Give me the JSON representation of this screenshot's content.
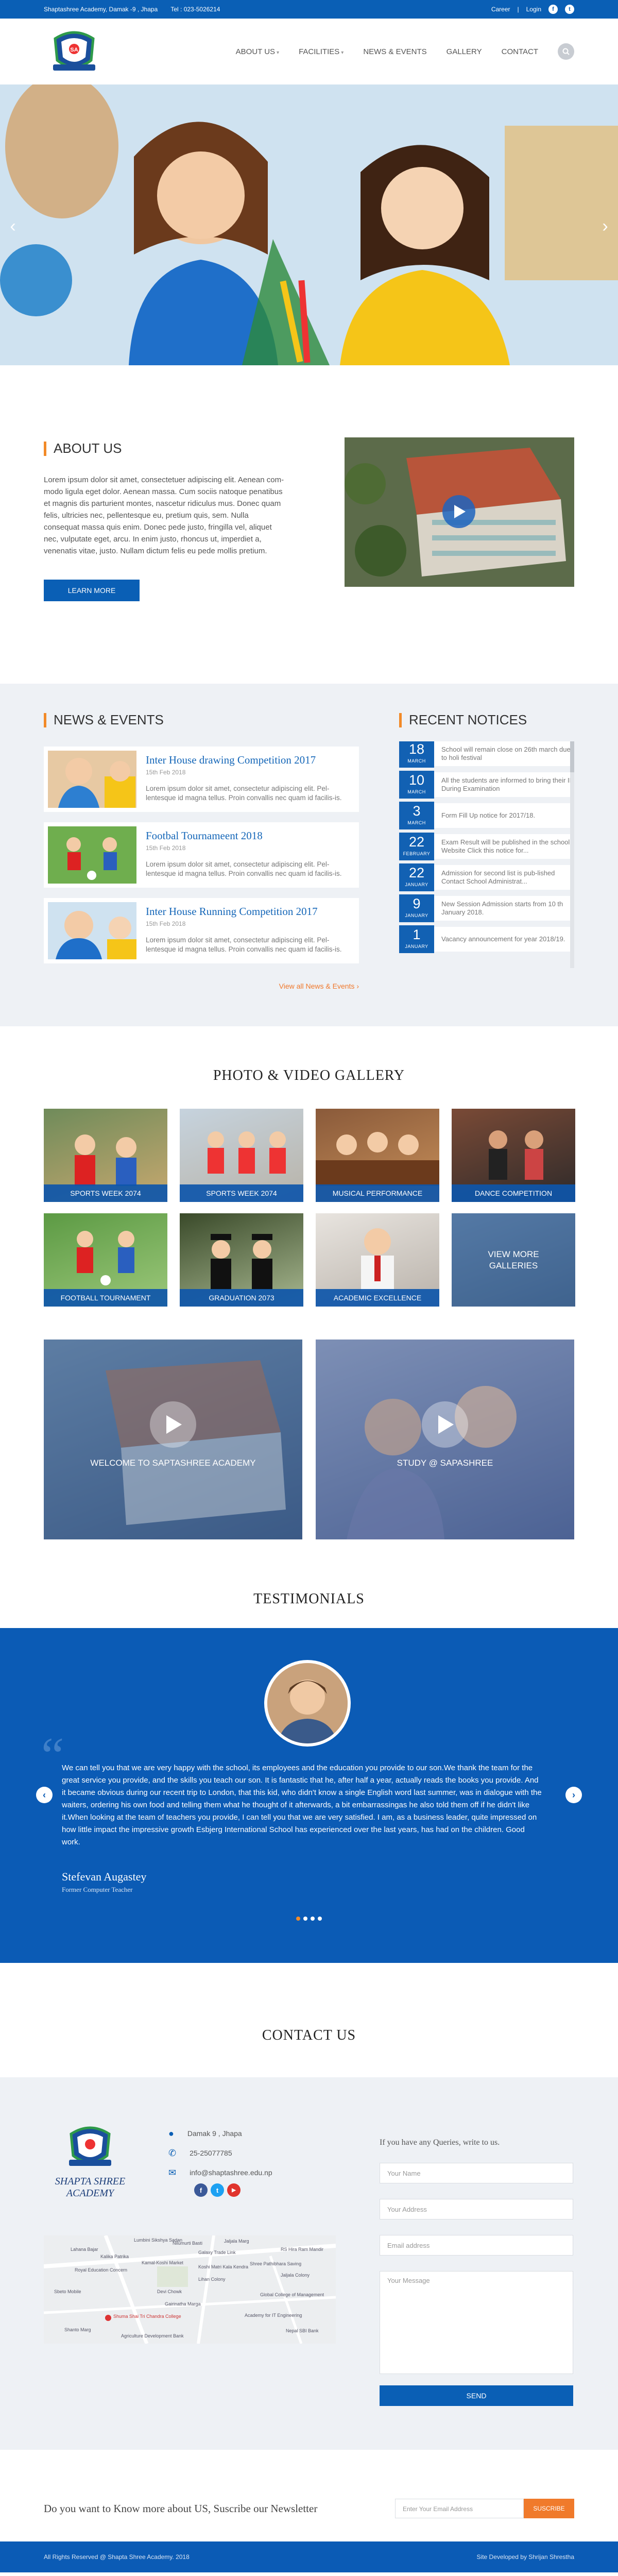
{
  "topbar": {
    "address": "Shaptashree Academy, Damak -9 , Jhapa",
    "phone": "Tel : 023-5026214",
    "career": "Career",
    "separator": "|",
    "login": "Login",
    "facebook_icon": "f",
    "twitter_icon": "t"
  },
  "logo": {
    "badge_text": "SA"
  },
  "nav": {
    "items": [
      {
        "label": "ABOUT US",
        "has_dropdown": true
      },
      {
        "label": "FACILITIES",
        "has_dropdown": true
      },
      {
        "label": "NEWS & EVENTS",
        "has_dropdown": false
      },
      {
        "label": "GALLERY",
        "has_dropdown": false
      },
      {
        "label": "CONTACT",
        "has_dropdown": false
      }
    ],
    "search_icon": "search-icon"
  },
  "hero": {
    "prev": "‹",
    "next": "›"
  },
  "about": {
    "title": "ABOUT US",
    "text": "Lorem ipsum dolor sit amet, consectetuer adipiscing elit. Aenean com-modo ligula eget dolor. Aenean massa. Cum sociis natoque penatibus et magnis dis parturient montes, nascetur ridiculus mus. Donec quam felis, ultricies nec, pellentesque eu, pretium quis, sem. Nulla consequat massa quis enim. Donec pede justo, fringilla vel, aliquet nec, vulputate eget, arcu. In enim justo, rhoncus ut, imperdiet a, venenatis vitae, justo. Nullam dictum felis eu pede mollis pretium.",
    "button": "LEARN MORE"
  },
  "news": {
    "title": "NEWS & EVENTS",
    "items": [
      {
        "title": "Inter House drawing Competition 2017",
        "date": "15th Feb 2018",
        "text": "Lorem ipsum dolor sit amet, consectetur adipiscing elit. Pel-lentesque id magna tellus. Proin convallis nec quam id facilis-is."
      },
      {
        "title": "Footbal Tournameent 2018",
        "date": "15th Feb 2018",
        "text": "Lorem ipsum dolor sit amet, consectetur adipiscing elit. Pel-lentesque id magna tellus. Proin convallis nec quam id facilis-is."
      },
      {
        "title": "Inter House Running Competition 2017",
        "date": "15th Feb 2018",
        "text": "Lorem ipsum dolor sit amet, consectetur adipiscing elit. Pel-lentesque id magna tellus. Proin convallis nec quam id facilis-is."
      }
    ],
    "view_all": "View all News & Events"
  },
  "notices": {
    "title": "RECENT NOTICES",
    "items": [
      {
        "day": "18",
        "month": "MARCH",
        "text": "School will remain close on 26th march due to holi festival"
      },
      {
        "day": "10",
        "month": "MARCH",
        "text": "All the students are informed to bring their ID During Examination"
      },
      {
        "day": "3",
        "month": "MARCH",
        "text": "Form Fill Up notice for 2017/18."
      },
      {
        "day": "22",
        "month": "FEBRUARY",
        "text": "Exam Result will be published in the school Website Click this notice for..."
      },
      {
        "day": "22",
        "month": "JANUARY",
        "text": "Admission for second list is pub-lished Contact School Administrat..."
      },
      {
        "day": "9",
        "month": "JANUARY",
        "text": "New Session Admission starts from 10 th January 2018."
      },
      {
        "day": "1",
        "month": "JANUARY",
        "text": "Vacancy announcement for year 2018/19."
      }
    ]
  },
  "gallery": {
    "title": "PHOTO & VIDEO GALLERY",
    "items": [
      {
        "label": "SPORTS WEEK 2074"
      },
      {
        "label": "SPORTS WEEK 2074"
      },
      {
        "label": "MUSICAL PERFORMANCE"
      },
      {
        "label": "DANCE COMPETITION"
      },
      {
        "label": "FOOTBALL TOURNAMENT"
      },
      {
        "label": "GRADUATION 2073"
      },
      {
        "label": "ACADEMIC EXCELLENCE"
      }
    ],
    "view_more": "VIEW MORE GALLERIES",
    "videos": [
      {
        "label": "WELCOME TO SAPTASHREE ACADEMY"
      },
      {
        "label": "STUDY @ SAPASHREE"
      }
    ]
  },
  "testimonials": {
    "title": "TESTIMONIALS",
    "quote_mark": "“",
    "text": "We can tell you that we are very happy with the school, its employees and the education you provide to our son.We thank the team for the great service you provide, and the skills you teach our son. It is fantastic that he, after half a year, actually reads the books you provide. And it became obvious during our recent trip to London, that this kid, who didn't know a single English word last summer, was in dialogue with the waiters, ordering his own food and telling them what he thought of it afterwards, a bit embarrassingas he also told them off if he didn't like it.When looking at the team of teachers you provide, I can tell you that we are very satisfied. I am, as a business leader, quite impressed on how little impact the impressive growth Esbjerg International School has experienced over the last years, has had on the children. Good work.",
    "name": "Stefevan Augastey",
    "role": "Former Computer Teacher",
    "prev": "‹",
    "next": "›"
  },
  "contact": {
    "title": "CONTACT US",
    "logo_text": "SHAPTA SHREE ACADEMY",
    "address": "Damak 9 , Jhapa",
    "phone": "25-25077785",
    "email": "info@shaptashree.edu.np",
    "social": {
      "facebook": "f",
      "twitter": "t",
      "youtube": "▶"
    },
    "map": {
      "labels": [
        "Lumbini Sikshya Sadan",
        "Lahana Bajar",
        "Kalika Patrika",
        "Jaljala Marg",
        "Nilumurti Basti",
        "Galaxy Trade Link",
        "Kamal-Koshi Market",
        "Royal Education Concern",
        "Shree Pathibhara Saving",
        "Global College of Management",
        "Academy for IT Engineering",
        "Devi Chowk",
        "Sbeto Mobile",
        "Lihan Colony",
        "Gairinatha Marga",
        "Shanto Marg",
        "Agriculture Development Bank",
        "Shuma Shai Tri Chandra College",
        "RS Hira Ram Mandir",
        "Jaljala Colony",
        "Koshi Matri Kala Kendra",
        "Nepal SBI Bank"
      ]
    },
    "form": {
      "heading": "If you have any Queries, write to us.",
      "name_placeholder": "Your Name",
      "address_placeholder": "Your Address",
      "email_placeholder": "Email address",
      "message_placeholder": "Your Message",
      "send": "SEND"
    }
  },
  "newsletter": {
    "text": "Do you want to Know more about US, Suscribe our Newsletter",
    "placeholder": "Enter Your Email Address",
    "button": "SUSCRIBE"
  },
  "footer": {
    "copyright": "All Rights Reserved @ Shapta Shree Academy. 2018",
    "developer": "Site Developed  by  Shrijan Shrestha"
  },
  "colors": {
    "primary": "#0a5fb5",
    "accent": "#f28a28",
    "background_alt": "#eef1f5"
  }
}
